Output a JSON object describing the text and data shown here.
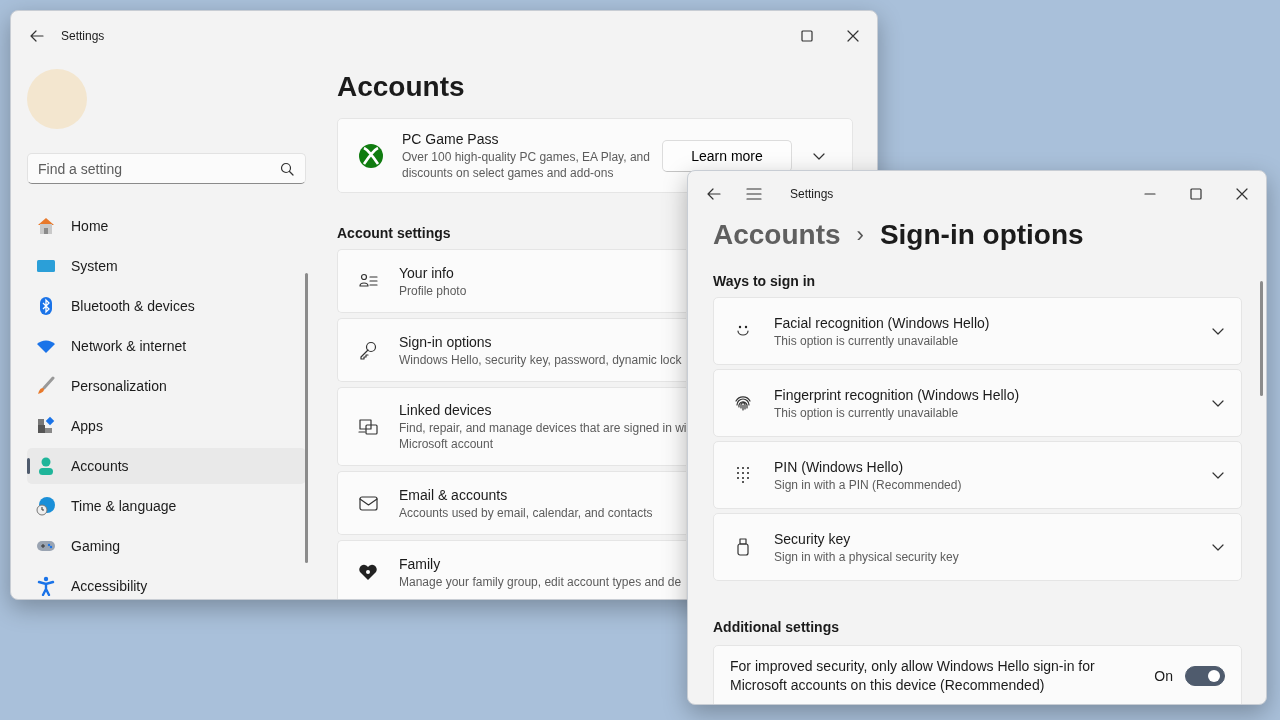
{
  "back_window": {
    "title": "Settings",
    "search": {
      "placeholder": "Find a setting"
    },
    "nav": [
      {
        "label": "Home",
        "selected": false
      },
      {
        "label": "System",
        "selected": false
      },
      {
        "label": "Bluetooth & devices",
        "selected": false
      },
      {
        "label": "Network & internet",
        "selected": false
      },
      {
        "label": "Personalization",
        "selected": false
      },
      {
        "label": "Apps",
        "selected": false
      },
      {
        "label": "Accounts",
        "selected": true
      },
      {
        "label": "Time & language",
        "selected": false
      },
      {
        "label": "Gaming",
        "selected": false
      },
      {
        "label": "Accessibility",
        "selected": false
      }
    ],
    "heading": "Accounts",
    "promo": {
      "title": "PC Game Pass",
      "description": "Over 100 high-quality PC games, EA Play, and discounts on select games and add-ons",
      "button": "Learn more"
    },
    "section_title": "Account settings",
    "cards": [
      {
        "title": "Your info",
        "description": "Profile photo"
      },
      {
        "title": "Sign-in options",
        "description": "Windows Hello, security key, password, dynamic lock"
      },
      {
        "title": "Linked devices",
        "description": "Find, repair, and manage devices that are signed in wi",
        "description_2": "Microsoft account"
      },
      {
        "title": "Email & accounts",
        "description": "Accounts used by email, calendar, and contacts"
      },
      {
        "title": "Family",
        "description": "Manage your family group, edit account types and de"
      }
    ]
  },
  "front_window": {
    "title": "Settings",
    "breadcrumb": {
      "parent": "Accounts",
      "separator": "›",
      "current": "Sign-in options"
    },
    "ways_title": "Ways to sign in",
    "ways": [
      {
        "title": "Facial recognition (Windows Hello)",
        "description": "This option is currently unavailable"
      },
      {
        "title": "Fingerprint recognition (Windows Hello)",
        "description": "This option is currently unavailable"
      },
      {
        "title": "PIN (Windows Hello)",
        "description": "Sign in with a PIN (Recommended)"
      },
      {
        "title": "Security key",
        "description": "Sign in with a physical security key"
      }
    ],
    "additional_title": "Additional settings",
    "additional": [
      {
        "text": "For improved security, only allow Windows Hello sign-in for Microsoft accounts on this device (Recommended)",
        "state_label": "On",
        "on": true
      }
    ]
  }
}
